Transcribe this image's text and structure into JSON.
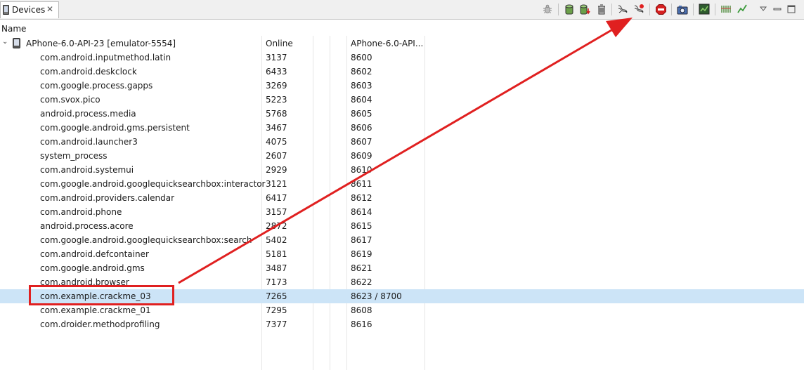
{
  "tab": {
    "title": "Devices",
    "close": "✕"
  },
  "toolbar": {
    "debug": "debug-bug",
    "update_heap": "update-heap",
    "dump_hprof": "dump-hprof",
    "gc": "cause-gc",
    "update_threads": "update-threads",
    "method_profiling": "start-method-profiling",
    "stop": "stop-process",
    "screen_capture": "screen-capture",
    "systrace": "systrace",
    "opengl_trace": "opengl-trace",
    "hierarchy": "dump-view-hierarchy",
    "menu": "view-menu",
    "minimize": "minimize",
    "maximize": "maximize"
  },
  "columns": {
    "name": "Name"
  },
  "device": {
    "toggle": "⌄",
    "name": "APhone-6.0-API-23 [emulator-5554]",
    "status": "Online",
    "serial": "APhone-6.0-API..."
  },
  "processes": [
    {
      "name": "com.android.inputmethod.latin",
      "pid": "3137",
      "port": "8600"
    },
    {
      "name": "com.android.deskclock",
      "pid": "6433",
      "port": "8602"
    },
    {
      "name": "com.google.process.gapps",
      "pid": "3269",
      "port": "8603"
    },
    {
      "name": "com.svox.pico",
      "pid": "5223",
      "port": "8604"
    },
    {
      "name": "android.process.media",
      "pid": "5768",
      "port": "8605"
    },
    {
      "name": "com.google.android.gms.persistent",
      "pid": "3467",
      "port": "8606"
    },
    {
      "name": "com.android.launcher3",
      "pid": "4075",
      "port": "8607"
    },
    {
      "name": "system_process",
      "pid": "2607",
      "port": "8609"
    },
    {
      "name": "com.android.systemui",
      "pid": "2929",
      "port": "8610"
    },
    {
      "name": "com.google.android.googlequicksearchbox:interactor",
      "pid": "3121",
      "port": "8611"
    },
    {
      "name": "com.android.providers.calendar",
      "pid": "6417",
      "port": "8612"
    },
    {
      "name": "com.android.phone",
      "pid": "3157",
      "port": "8614"
    },
    {
      "name": "android.process.acore",
      "pid": "2872",
      "port": "8615"
    },
    {
      "name": "com.google.android.googlequicksearchbox:search",
      "pid": "5402",
      "port": "8617"
    },
    {
      "name": "com.android.defcontainer",
      "pid": "5181",
      "port": "8619"
    },
    {
      "name": "com.google.android.gms",
      "pid": "3487",
      "port": "8621"
    },
    {
      "name": "com.android.browser",
      "pid": "7173",
      "port": "8622"
    },
    {
      "name": "com.example.crackme_03",
      "pid": "7265",
      "port": "8623 / 8700"
    },
    {
      "name": "com.example.crackme_01",
      "pid": "7295",
      "port": "8608"
    },
    {
      "name": "com.droider.methodprofiling",
      "pid": "7377",
      "port": "8616"
    }
  ],
  "selected_index": 17,
  "annotation": {
    "color": "#e02020",
    "target": "method-profiling-button"
  },
  "colors": {
    "selection": "#cce4f7",
    "annotation": "#e02020"
  }
}
